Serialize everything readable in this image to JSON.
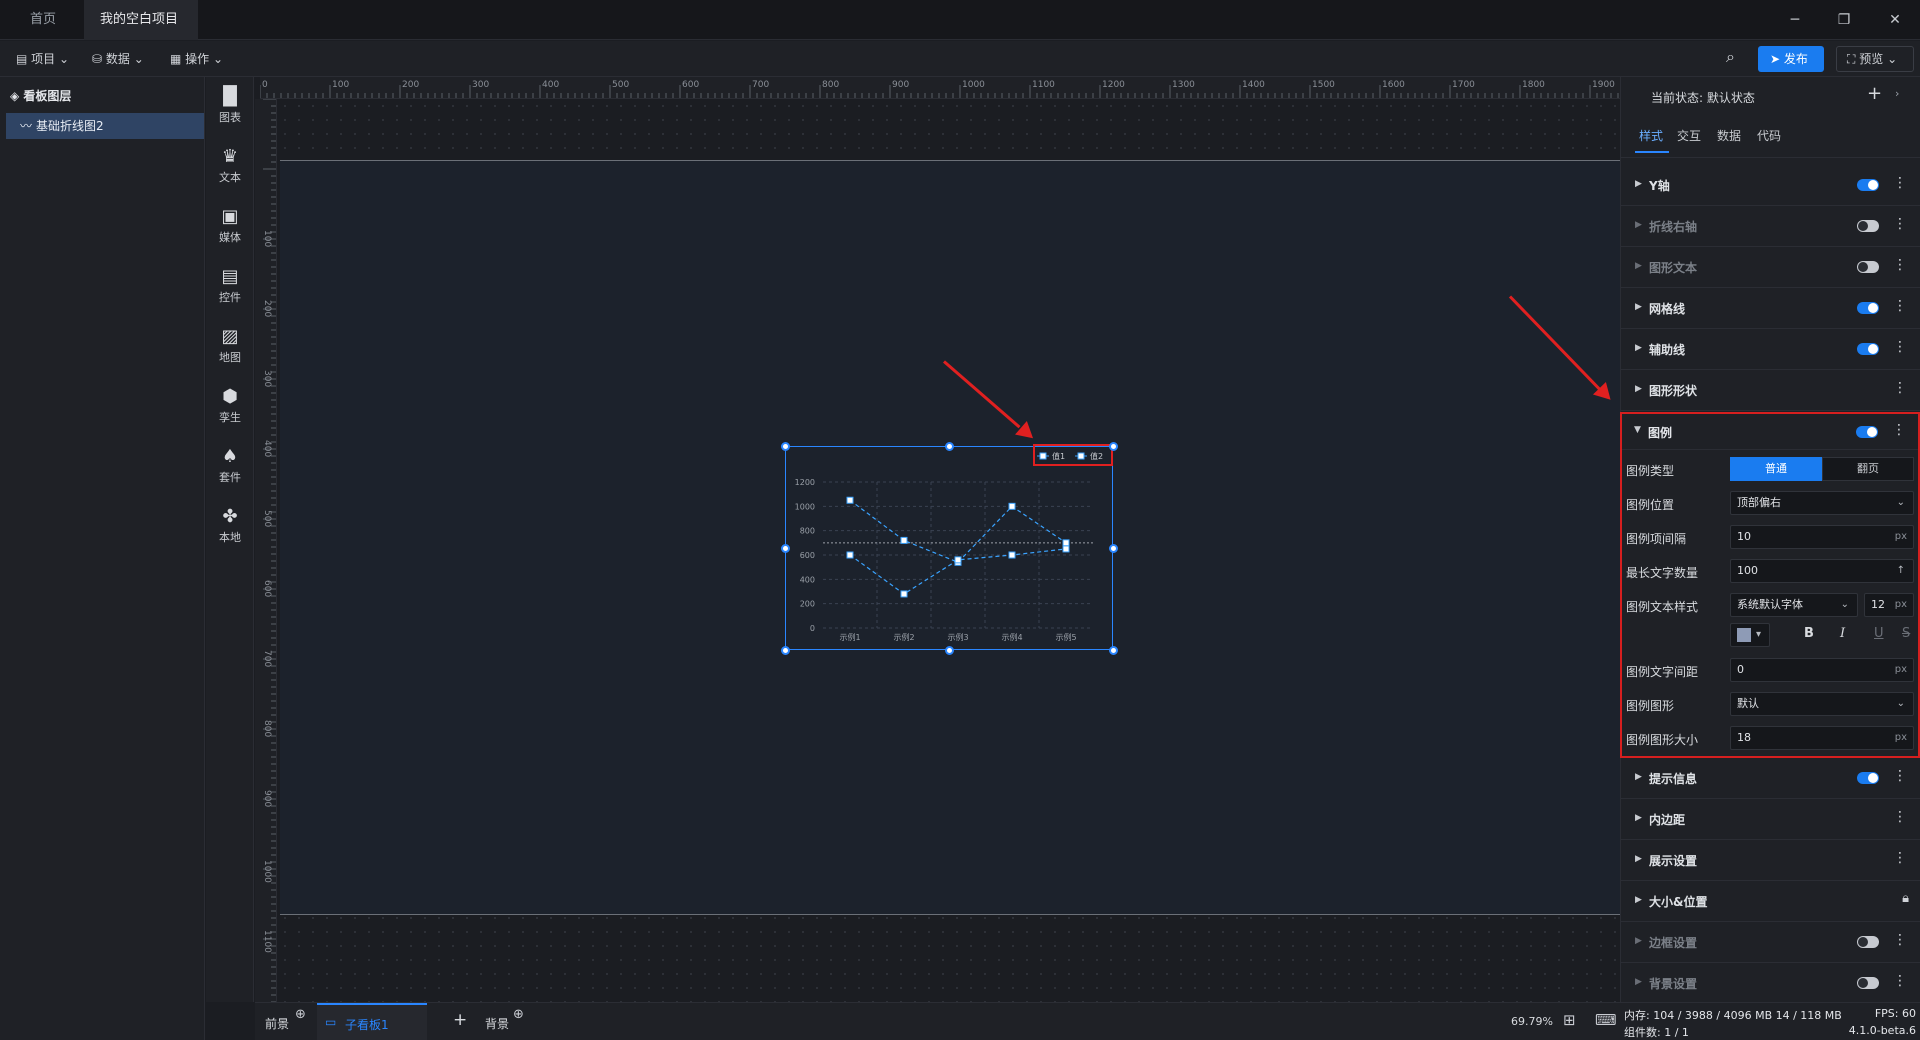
{
  "titlebar": {
    "tabs": [
      {
        "label": "首页"
      },
      {
        "label": "我的空白项目"
      }
    ]
  },
  "menubar": {
    "project": "项目",
    "data": "数据",
    "ops": "操作",
    "publish": "发布",
    "preview": "预览"
  },
  "layers": {
    "title": "看板图层",
    "items": [
      {
        "label": "基础折线图2"
      }
    ]
  },
  "toolbar": {
    "items": [
      {
        "label": "图表"
      },
      {
        "label": "文本"
      },
      {
        "label": "媒体"
      },
      {
        "label": "控件"
      },
      {
        "label": "地图"
      },
      {
        "label": "孪生"
      },
      {
        "label": "套件"
      },
      {
        "label": "本地"
      }
    ]
  },
  "ruler": {
    "top": [
      "0",
      "100",
      "200",
      "300",
      "400",
      "500",
      "600",
      "700",
      "800",
      "900",
      "1000",
      "1100",
      "1200",
      "1300",
      "1400",
      "1500",
      "1600",
      "1700",
      "1800",
      "1900"
    ],
    "left": [
      "100",
      "200",
      "300",
      "400",
      "500",
      "600",
      "700",
      "800",
      "900",
      "1000",
      "1100"
    ]
  },
  "chart_data": {
    "type": "line",
    "categories": [
      "示例1",
      "示例2",
      "示例3",
      "示例4",
      "示例5"
    ],
    "series": [
      {
        "name": "值1",
        "values": [
          1050,
          720,
          540,
          1000,
          700
        ]
      },
      {
        "name": "值2",
        "values": [
          600,
          280,
          560,
          600,
          650
        ]
      }
    ],
    "yticks": [
      "1200",
      "1000",
      "800",
      "600",
      "400",
      "200",
      "0"
    ],
    "ylim": [
      0,
      1200
    ],
    "reference_line": 700,
    "legend_position": "top-right",
    "color": "#3aa3ff"
  },
  "right_panel": {
    "state_label": "当前状态:",
    "state_value": "默认状态",
    "tabs": [
      "样式",
      "交互",
      "数据",
      "代码"
    ],
    "sections_top": [
      {
        "label": "Y轴",
        "toggle": "on"
      },
      {
        "label": "折线右轴",
        "toggle": "off",
        "dim": true
      },
      {
        "label": "图形文本",
        "toggle": "off",
        "dim": true
      },
      {
        "label": "网格线",
        "toggle": "on"
      },
      {
        "label": "辅助线",
        "toggle": "on"
      },
      {
        "label": "图形形状",
        "toggle": "none"
      }
    ],
    "legend": {
      "title": "图例",
      "type_label": "图例类型",
      "type_opt1": "普通",
      "type_opt2": "翻页",
      "pos_label": "图例位置",
      "pos_value": "顶部偏右",
      "gap_label": "图例项间隔",
      "gap_value": "10",
      "maxtext_label": "最长文字数量",
      "maxtext_value": "100",
      "textstyle_label": "图例文本样式",
      "font_value": "系统默认字体",
      "size_value": "12",
      "spacing_label": "图例文字间距",
      "spacing_value": "0",
      "shape_label": "图例图形",
      "shape_value": "默认",
      "shapesize_label": "图例图形大小",
      "shapesize_value": "18",
      "unit": "px"
    },
    "sections_bottom": [
      {
        "label": "提示信息",
        "toggle": "on"
      },
      {
        "label": "内边距",
        "toggle": "none"
      },
      {
        "label": "展示设置",
        "toggle": "none"
      },
      {
        "label": "大小&位置",
        "toggle": "lock"
      },
      {
        "label": "边框设置",
        "toggle": "off",
        "dim": true
      },
      {
        "label": "背景设置",
        "toggle": "off",
        "dim": true
      }
    ]
  },
  "statusbar": {
    "front": "前景",
    "board": "子看板1",
    "background": "背景",
    "zoom": "69.79%"
  },
  "status_right": {
    "memory": "内存: 104 / 3988 / 4096 MB 14 / 118 MB",
    "fps": "FPS: 60",
    "components": "组件数: 1 / 1",
    "version": "4.1.0-beta.6"
  }
}
